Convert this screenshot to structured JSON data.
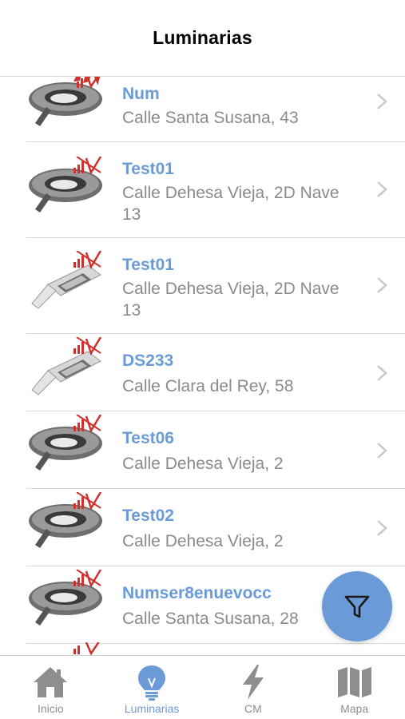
{
  "header": {
    "title": "Luminarias"
  },
  "list": {
    "items": [
      {
        "name": "Num",
        "address": "Calle Santa Susana, 43",
        "icon": "round-streetlight-icon"
      },
      {
        "name": "Test01",
        "address": "Calle Dehesa Vieja, 2D Nave 13",
        "icon": "round-streetlight-icon"
      },
      {
        "name": "Test01",
        "address": "Calle Dehesa Vieja, 2D Nave 13",
        "icon": "rectangular-streetlight-icon"
      },
      {
        "name": "DS233",
        "address": "Calle Clara del Rey, 58",
        "icon": "rectangular-streetlight-icon"
      },
      {
        "name": "Test06",
        "address": "Calle Dehesa Vieja, 2",
        "icon": "round-streetlight-icon"
      },
      {
        "name": "Test02",
        "address": "Calle Dehesa Vieja, 2",
        "icon": "round-streetlight-icon"
      },
      {
        "name": "Numser8enuevocc",
        "address": "Calle Santa Susana, 28",
        "icon": "round-streetlight-icon"
      }
    ]
  },
  "fab": {
    "icon": "filter-icon"
  },
  "tabbar": {
    "tabs": [
      {
        "label": "Inicio",
        "icon": "home-icon",
        "active": false
      },
      {
        "label": "Luminarias",
        "icon": "lightbulb-icon",
        "active": true
      },
      {
        "label": "CM",
        "icon": "lightning-icon",
        "active": false
      },
      {
        "label": "Mapa",
        "icon": "map-icon",
        "active": false
      }
    ]
  },
  "colors": {
    "accent": "#6a9bd8",
    "secondary_text": "#8a8a8a",
    "inactive_tab": "#8e8e8e",
    "signal_red": "#d0312d"
  }
}
